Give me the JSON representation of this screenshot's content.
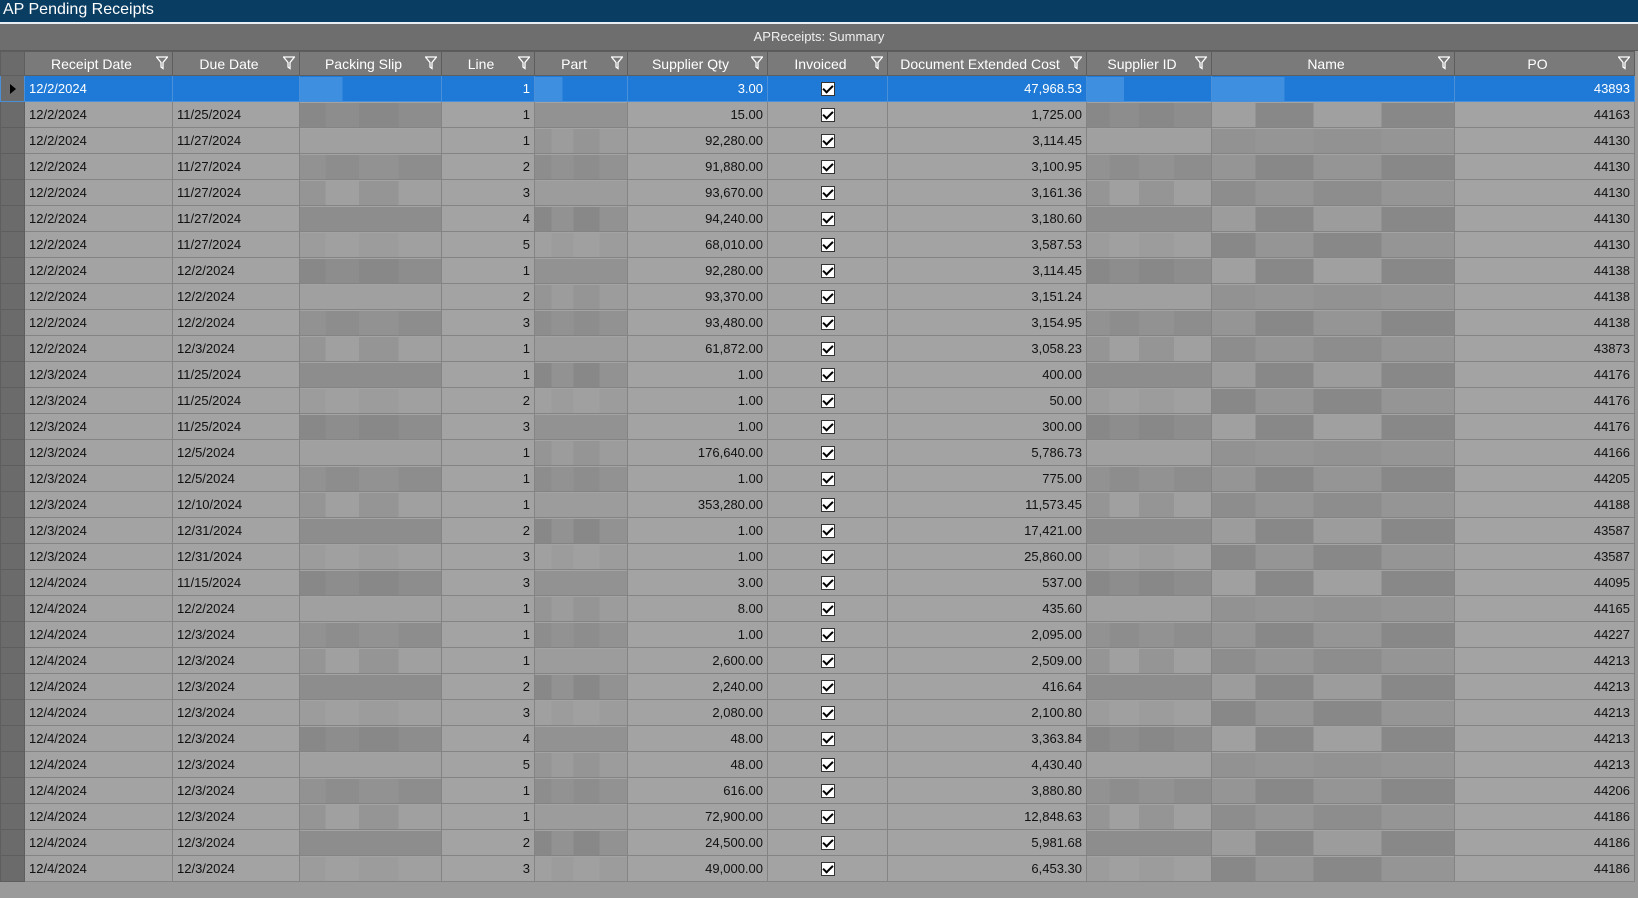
{
  "window": {
    "title": "AP Pending Receipts"
  },
  "grid": {
    "caption": "APReceipts: Summary",
    "columns": [
      "Receipt Date",
      "Due Date",
      "Packing Slip",
      "Line",
      "Part",
      "Supplier Qty",
      "Invoiced",
      "Document Extended Cost",
      "Supplier ID",
      "Name",
      "PO"
    ],
    "rows": [
      [
        "12/2/2024",
        "",
        "",
        "1",
        "",
        "3.00",
        "checked",
        "47,968.53",
        "",
        "",
        "43893"
      ],
      [
        "12/2/2024",
        "11/25/2024",
        "",
        "1",
        "",
        "15.00",
        "checked",
        "1,725.00",
        "",
        "",
        "44163"
      ],
      [
        "12/2/2024",
        "11/27/2024",
        "",
        "1",
        "",
        "92,280.00",
        "checked",
        "3,114.45",
        "",
        "",
        "44130"
      ],
      [
        "12/2/2024",
        "11/27/2024",
        "",
        "2",
        "",
        "91,880.00",
        "checked",
        "3,100.95",
        "",
        "",
        "44130"
      ],
      [
        "12/2/2024",
        "11/27/2024",
        "",
        "3",
        "",
        "93,670.00",
        "checked",
        "3,161.36",
        "",
        "",
        "44130"
      ],
      [
        "12/2/2024",
        "11/27/2024",
        "",
        "4",
        "",
        "94,240.00",
        "checked",
        "3,180.60",
        "",
        "",
        "44130"
      ],
      [
        "12/2/2024",
        "11/27/2024",
        "",
        "5",
        "",
        "68,010.00",
        "checked",
        "3,587.53",
        "",
        "",
        "44130"
      ],
      [
        "12/2/2024",
        "12/2/2024",
        "",
        "1",
        "",
        "92,280.00",
        "checked",
        "3,114.45",
        "",
        "",
        "44138"
      ],
      [
        "12/2/2024",
        "12/2/2024",
        "",
        "2",
        "",
        "93,370.00",
        "checked",
        "3,151.24",
        "",
        "",
        "44138"
      ],
      [
        "12/2/2024",
        "12/2/2024",
        "",
        "3",
        "",
        "93,480.00",
        "checked",
        "3,154.95",
        "",
        "",
        "44138"
      ],
      [
        "12/2/2024",
        "12/3/2024",
        "",
        "1",
        "",
        "61,872.00",
        "checked",
        "3,058.23",
        "",
        "",
        "43873"
      ],
      [
        "12/3/2024",
        "11/25/2024",
        "",
        "1",
        "",
        "1.00",
        "checked",
        "400.00",
        "",
        "",
        "44176"
      ],
      [
        "12/3/2024",
        "11/25/2024",
        "",
        "2",
        "",
        "1.00",
        "checked",
        "50.00",
        "",
        "",
        "44176"
      ],
      [
        "12/3/2024",
        "11/25/2024",
        "",
        "3",
        "",
        "1.00",
        "checked",
        "300.00",
        "",
        "",
        "44176"
      ],
      [
        "12/3/2024",
        "12/5/2024",
        "",
        "1",
        "",
        "176,640.00",
        "checked",
        "5,786.73",
        "",
        "",
        "44166"
      ],
      [
        "12/3/2024",
        "12/5/2024",
        "",
        "1",
        "",
        "1.00",
        "checked",
        "775.00",
        "",
        "",
        "44205"
      ],
      [
        "12/3/2024",
        "12/10/2024",
        "",
        "1",
        "",
        "353,280.00",
        "checked",
        "11,573.45",
        "",
        "",
        "44188"
      ],
      [
        "12/3/2024",
        "12/31/2024",
        "",
        "2",
        "",
        "1.00",
        "checked",
        "17,421.00",
        "",
        "",
        "43587"
      ],
      [
        "12/3/2024",
        "12/31/2024",
        "",
        "3",
        "",
        "1.00",
        "checked",
        "25,860.00",
        "",
        "",
        "43587"
      ],
      [
        "12/4/2024",
        "11/15/2024",
        "",
        "3",
        "",
        "3.00",
        "checked",
        "537.00",
        "",
        "",
        "44095"
      ],
      [
        "12/4/2024",
        "12/2/2024",
        "",
        "1",
        "",
        "8.00",
        "checked",
        "435.60",
        "",
        "",
        "44165"
      ],
      [
        "12/4/2024",
        "12/3/2024",
        "",
        "1",
        "",
        "1.00",
        "checked",
        "2,095.00",
        "",
        "",
        "44227"
      ],
      [
        "12/4/2024",
        "12/3/2024",
        "",
        "1",
        "",
        "2,600.00",
        "checked",
        "2,509.00",
        "",
        "",
        "44213"
      ],
      [
        "12/4/2024",
        "12/3/2024",
        "",
        "2",
        "",
        "2,240.00",
        "checked",
        "416.64",
        "",
        "",
        "44213"
      ],
      [
        "12/4/2024",
        "12/3/2024",
        "",
        "3",
        "",
        "2,080.00",
        "checked",
        "2,100.80",
        "",
        "",
        "44213"
      ],
      [
        "12/4/2024",
        "12/3/2024",
        "",
        "4",
        "",
        "48.00",
        "checked",
        "3,363.84",
        "",
        "",
        "44213"
      ],
      [
        "12/4/2024",
        "12/3/2024",
        "",
        "5",
        "",
        "48.00",
        "checked",
        "4,430.40",
        "",
        "",
        "44213"
      ],
      [
        "12/4/2024",
        "12/3/2024",
        "",
        "1",
        "",
        "616.00",
        "checked",
        "3,880.80",
        "",
        "",
        "44206"
      ],
      [
        "12/4/2024",
        "12/3/2024",
        "",
        "1",
        "",
        "72,900.00",
        "checked",
        "12,848.63",
        "",
        "",
        "44186"
      ],
      [
        "12/4/2024",
        "12/3/2024",
        "",
        "2",
        "",
        "24,500.00",
        "checked",
        "5,981.68",
        "",
        "",
        "44186"
      ],
      [
        "12/4/2024",
        "12/3/2024",
        "",
        "3",
        "",
        "49,000.00",
        "checked",
        "6,453.30",
        "",
        "",
        "44186"
      ]
    ]
  },
  "colors": {
    "title_bar": "#0a3d62",
    "selection": "#1e7ad6",
    "grid_bg": "#a3a3a3",
    "header_bg": "#7a7a7a"
  },
  "icons": {
    "filter": "filter-icon",
    "row_indicator": "current-row-arrow-icon",
    "check": "checkbox-checked-icon"
  }
}
